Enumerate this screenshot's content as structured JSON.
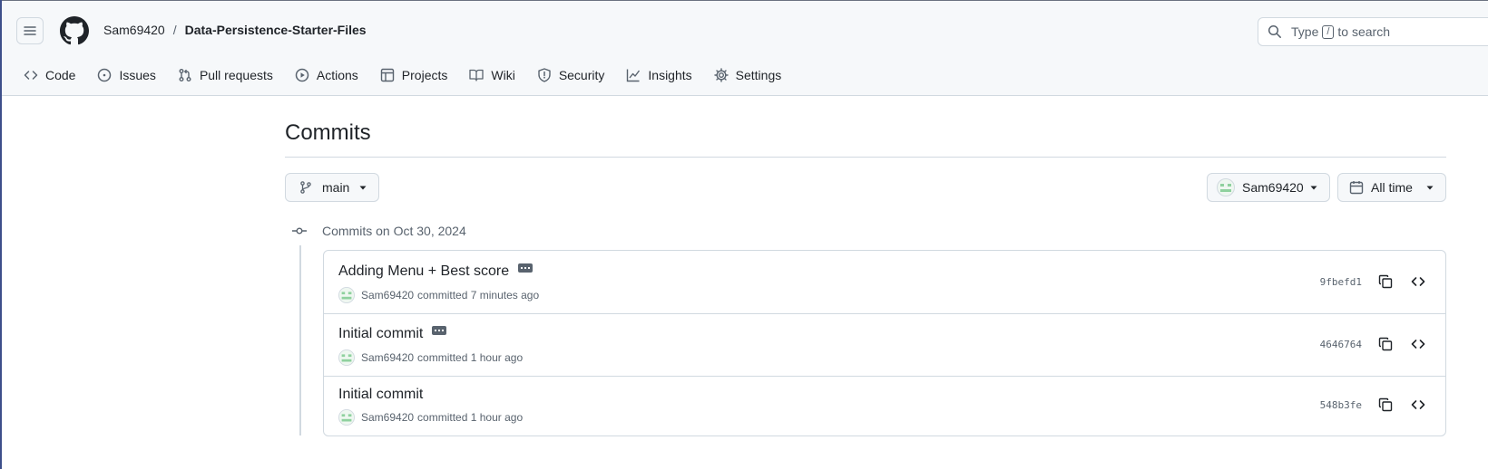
{
  "header": {
    "owner": "Sam69420",
    "separator": "/",
    "repo": "Data-Persistence-Starter-Files",
    "search": {
      "prefix": "Type",
      "key": "/",
      "suffix": "to search"
    }
  },
  "tabs": [
    {
      "label": "Code",
      "icon": "code-icon"
    },
    {
      "label": "Issues",
      "icon": "issue-opened-icon"
    },
    {
      "label": "Pull requests",
      "icon": "git-pull-request-icon"
    },
    {
      "label": "Actions",
      "icon": "play-icon"
    },
    {
      "label": "Projects",
      "icon": "table-icon"
    },
    {
      "label": "Wiki",
      "icon": "book-icon"
    },
    {
      "label": "Security",
      "icon": "shield-icon"
    },
    {
      "label": "Insights",
      "icon": "graph-icon"
    },
    {
      "label": "Settings",
      "icon": "gear-icon"
    }
  ],
  "page": {
    "title": "Commits",
    "branch": "main",
    "author": "Sam69420",
    "time_filter": "All time",
    "group_label": "Commits on Oct 30, 2024"
  },
  "commits": [
    {
      "message": "Adding Menu + Best score",
      "has_ellipsis": true,
      "author": "Sam69420",
      "action": "committed",
      "time": "7 minutes ago",
      "sha": "9fbefd1"
    },
    {
      "message": "Initial commit",
      "has_ellipsis": true,
      "author": "Sam69420",
      "action": "committed",
      "time": "1 hour ago",
      "sha": "4646764"
    },
    {
      "message": "Initial commit",
      "has_ellipsis": false,
      "author": "Sam69420",
      "action": "committed",
      "time": "1 hour ago",
      "sha": "548b3fe"
    }
  ],
  "colors": {
    "text": "#1f2328",
    "muted": "#59636e",
    "border": "#d1d9e0",
    "header_bg": "#f6f8fa",
    "avatar": "#8fd19e"
  }
}
